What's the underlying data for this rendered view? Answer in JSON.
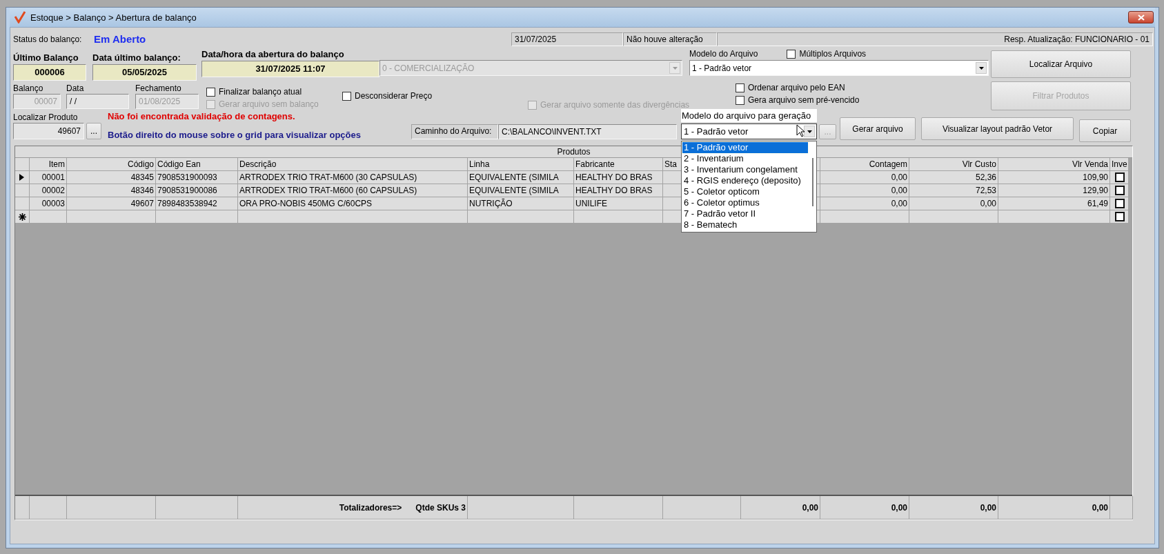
{
  "window": {
    "title": "Estoque > Balanço > Abertura de balanço"
  },
  "status": {
    "label": "Status do balanço:",
    "value": "Em Aberto",
    "date": "31/07/2025",
    "change": "Não houve alteração",
    "responsible": "Resp. Atualização: FUNCIONARIO - 01"
  },
  "summary": [
    {
      "label": "Último Balanço",
      "value": "000006"
    },
    {
      "label": "Data último balanço:",
      "value": "05/05/2025"
    },
    {
      "label": "Data/hora da abertura do balanço",
      "value": "31/07/2025 11:07"
    }
  ],
  "operation_combo": {
    "value": "0 - COMERCIALIZAÇÃO",
    "disabled": true
  },
  "file_model": {
    "label": "Modelo do Arquivo",
    "value": "1 - Padrão vetor"
  },
  "multiple_files": {
    "label": "Múltiplos Arquivos",
    "checked": false,
    "disabled": false
  },
  "locate_file_button": {
    "label": "Localizar Arquivo",
    "disabled": false
  },
  "fields": [
    {
      "label": "Balanço",
      "value": "00007",
      "disabled": true
    },
    {
      "label": "Data",
      "value": "/ /",
      "disabled": false
    },
    {
      "label": "Fechamento",
      "value": "01/08/2025",
      "disabled": true
    }
  ],
  "options_left": [
    {
      "label": "Finalizar balanço atual",
      "checked": false,
      "disabled": false
    },
    {
      "label": "Gerar arquivo sem balanço",
      "checked": false,
      "disabled": true
    }
  ],
  "ignore_price": {
    "label": "Desconsiderar Preço",
    "checked": false,
    "disabled": false
  },
  "only_divergences": {
    "label": "Gerar arquivo somente das divergências",
    "checked": false,
    "disabled": true
  },
  "options_right": [
    {
      "label": "Ordenar arquivo pelo EAN",
      "checked": false,
      "disabled": false
    },
    {
      "label": "Gera arquivo sem pré-vencido",
      "checked": false,
      "disabled": false
    }
  ],
  "filter_button": {
    "label": "Filtrar Produtos",
    "disabled": true
  },
  "product_search": {
    "label": "Localizar Produto",
    "value": "49607",
    "button": "..."
  },
  "messages": [
    {
      "text": "Não foi encontrada validação de contagens.",
      "kind": "error"
    },
    {
      "text": "Botão direito do mouse sobre o grid para visualizar opções",
      "kind": "hint"
    }
  ],
  "file_path": {
    "label": "Caminho do Arquivo:",
    "value": "C:\\BALANCO\\INVENT.TXT",
    "button": "...",
    "button_disabled": true
  },
  "generation_model": {
    "label": "Modelo do arquivo para geração",
    "value": "1 - Padrão vetor",
    "expanded": true,
    "options": [
      {
        "label": "1 - Padrão vetor",
        "selected": true
      },
      {
        "label": "2 - Inventarium",
        "selected": false
      },
      {
        "label": "3 - Inventarium congelament",
        "selected": false
      },
      {
        "label": "4 - RGIS endereço (deposito)",
        "selected": false
      },
      {
        "label": "5 - Coletor opticom",
        "selected": false
      },
      {
        "label": "6 - Coletor optimus",
        "selected": false
      },
      {
        "label": "7 - Padrão vetor II",
        "selected": false
      },
      {
        "label": "8 - Bematech",
        "selected": false
      }
    ]
  },
  "actions": [
    {
      "label": "Gerar arquivo"
    },
    {
      "label": "Visualizar layout padrão Vetor"
    },
    {
      "label": "Copiar"
    }
  ],
  "grid": {
    "title": "Produtos",
    "columns": [
      {
        "label": "Item"
      },
      {
        "label": "Código"
      },
      {
        "label": "Código Ean"
      },
      {
        "label": "Descrição"
      },
      {
        "label": "Linha"
      },
      {
        "label": "Fabricante"
      },
      {
        "label": "Sta"
      },
      {},
      {
        "label": "Contagem"
      },
      {
        "label": "Vlr Custo"
      },
      {
        "label": "Vlr Venda"
      },
      {
        "label": "Inve"
      }
    ],
    "rows": [
      {
        "kind": "data",
        "current": true,
        "cells": [
          "00001",
          "48345",
          "7908531900093",
          "ARTRODEX TRIO TRAT-M600 (30 CAPSULAS)",
          "EQUIVALENTE (SIMILA",
          "HEALTHY DO BRAS",
          null,
          null,
          "0,00",
          "52,36",
          "109,90"
        ],
        "inve": false
      },
      {
        "kind": "data",
        "current": false,
        "cells": [
          "00002",
          "48346",
          "7908531900086",
          "ARTRODEX TRIO TRAT-M600 (60 CAPSULAS)",
          "EQUIVALENTE (SIMILA",
          "HEALTHY DO BRAS",
          null,
          null,
          "0,00",
          "72,53",
          "129,90"
        ],
        "inve": false
      },
      {
        "kind": "data",
        "current": false,
        "cells": [
          "00003",
          "49607",
          "7898483538942",
          "ORA PRO-NOBIS 450MG C/60CPS",
          "NUTRIÇÃO",
          "UNILIFE",
          null,
          null,
          "0,00",
          "0,00",
          "61,49"
        ],
        "inve": false
      },
      {
        "kind": "new",
        "current": false,
        "inve": false
      }
    ],
    "totals": {
      "label": "Totalizadores=>",
      "count": "Qtde SKUs 3",
      "values": [
        "0,00",
        "0,00",
        "0,00",
        "0,00"
      ]
    }
  }
}
